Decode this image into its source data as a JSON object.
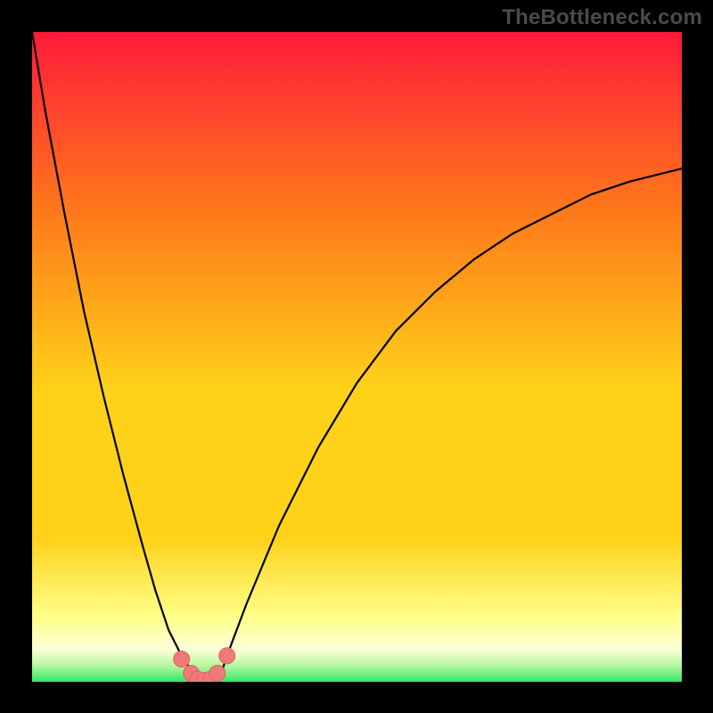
{
  "watermark": "TheBottleneck.com",
  "colors": {
    "frame": "#000000",
    "gradient_top": "#ff1a3a",
    "gradient_mid_upper": "#ff7a1a",
    "gradient_mid": "#ffd21a",
    "gradient_lower": "#ffff88",
    "gradient_bottom_band": "#fdffd8",
    "gradient_bottom": "#30e868",
    "curve": "#000000",
    "marker_fill": "#ef7b78",
    "marker_stroke": "#e06560"
  },
  "chart_data": {
    "type": "line",
    "title": "",
    "xlabel": "",
    "ylabel": "",
    "xlim": [
      0,
      100
    ],
    "ylim": [
      0,
      100
    ],
    "y_axis_inverted_note": "Lower y (near bottom) = better match; plotted with y=0 at bottom band, y=100 at top edge.",
    "series": [
      {
        "name": "bottleneck-curve",
        "x": [
          0,
          2,
          5,
          8,
          11,
          14,
          17,
          19,
          21,
          23,
          25,
          27,
          29,
          30,
          33,
          38,
          44,
          50,
          56,
          62,
          68,
          74,
          80,
          86,
          92,
          100
        ],
        "y": [
          100,
          88,
          72,
          57,
          44,
          32,
          21,
          14,
          8,
          4,
          1,
          0,
          1,
          4,
          12,
          24,
          36,
          46,
          54,
          60,
          65,
          69,
          72,
          75,
          77,
          79
        ]
      }
    ],
    "markers": {
      "name": "highlight-points",
      "x": [
        23,
        24.5,
        25.5,
        26.5,
        27.5,
        28.5,
        30
      ],
      "y": [
        3.5,
        1.3,
        0.4,
        0.2,
        0.4,
        1.3,
        4.0
      ]
    }
  }
}
